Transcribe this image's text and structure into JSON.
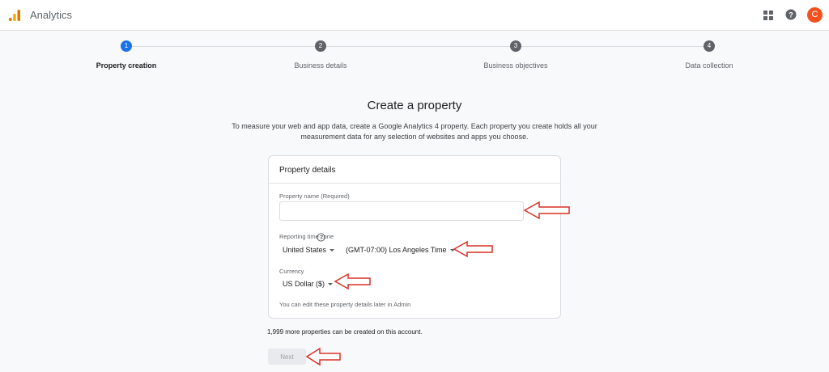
{
  "header": {
    "app_title": "Analytics",
    "logo_icon": "analytics-logo-icon",
    "apps_icon": "apps-grid-icon",
    "help_icon": "help-circle-icon",
    "avatar_initial": "C",
    "avatar_color": "#f4511e"
  },
  "stepper": {
    "steps": [
      {
        "number": "1",
        "label": "Property creation",
        "active": true
      },
      {
        "number": "2",
        "label": "Business details",
        "active": false
      },
      {
        "number": "3",
        "label": "Business objectives",
        "active": false
      },
      {
        "number": "4",
        "label": "Data collection",
        "active": false
      }
    ]
  },
  "main": {
    "title": "Create a property",
    "intro_line1": "To measure your web and app data, create a Google Analytics 4 property. Each property you create holds all your",
    "intro_line2": "measurement data for any selection of websites and apps you choose."
  },
  "card": {
    "title": "Property details",
    "name_label": "Property name (Required)",
    "name_value": "",
    "timezone_label": "Reporting time zone",
    "country_value": "United States",
    "timezone_value": "(GMT-07:00) Los Angeles Time",
    "currency_label": "Currency",
    "currency_value": "US Dollar ($)",
    "footnote": "You can edit these property details later in Admin"
  },
  "quota_text": "1,999 more properties can be created on this account.",
  "next_label": "Next",
  "colors": {
    "accent": "#1a73e8",
    "annotation_arrow": "#d93025"
  }
}
